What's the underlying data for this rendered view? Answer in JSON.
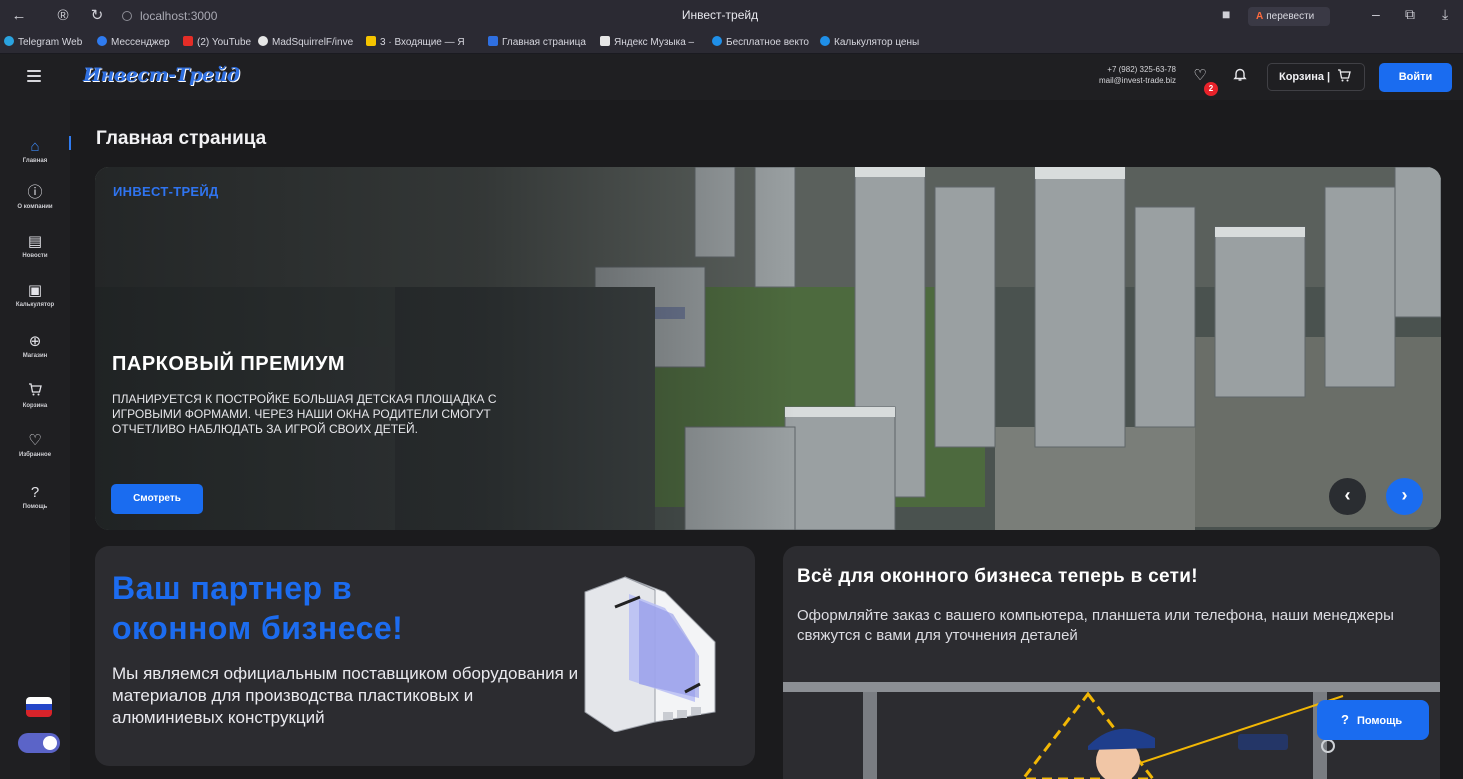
{
  "browser": {
    "url": "localhost:3000",
    "tab_title": "Инвест-трейд",
    "translate_label": "перевести",
    "bookmarks": [
      {
        "label": "Telegram Web",
        "color": "#2aa3e0"
      },
      {
        "label": "Мессенджер",
        "color": "#2f7bf0"
      },
      {
        "label": "(2) YouTube",
        "color": "#e52d27"
      },
      {
        "label": "MadSquirrelF/inve",
        "color": "#e6e6e6"
      },
      {
        "label": "3 · Входящие — Я",
        "color": "#f5c400"
      },
      {
        "label": "Главная страница",
        "color": "#2f6fe0"
      },
      {
        "label": "Яндекс Музыка –",
        "color": "#e6e6e6"
      },
      {
        "label": "Бесплатное векто",
        "color": "#1f8fe8"
      },
      {
        "label": "Калькулятор цены",
        "color": "#1f8fe8"
      }
    ]
  },
  "header": {
    "logo": "Инвест-Трейд",
    "phone": "+7 (982) 325-63-78",
    "email": "mail@invest-trade.biz",
    "favorites_count": "2",
    "cart_label": "Корзина |",
    "login_label": "Войти"
  },
  "sidebar": {
    "items": [
      {
        "label": "Главная",
        "icon": "home-icon"
      },
      {
        "label": "О компании",
        "icon": "question-circle-icon"
      },
      {
        "label": "Новости",
        "icon": "news-icon"
      },
      {
        "label": "Калькулятор",
        "icon": "calculator-icon"
      },
      {
        "label": "Магазин",
        "icon": "shop-icon"
      },
      {
        "label": "Корзина",
        "icon": "cart-icon"
      },
      {
        "label": "Избранное",
        "icon": "heart-icon"
      },
      {
        "label": "Помощь",
        "icon": "question-icon"
      }
    ]
  },
  "main": {
    "page_title": "Главная страница",
    "hero": {
      "brand": "ИНВЕСТ-ТРЕЙД",
      "title": "ПАРКОВЫЙ ПРЕМИУМ",
      "description": "Планируется к постройке большая детская площадка с игровыми формами. Через наши окна родители смогут отчетливо наблюдать за игрой своих детей.",
      "button_label": "Смотреть"
    },
    "partner": {
      "title_line1": "Ваш партнер в",
      "title_line2": "оконном бизнесе!",
      "description": "Мы являемся официальным поставщиком оборудования и материалов для производства пластиковых и алюминиевых конструкций"
    },
    "online": {
      "title": "Всё для оконного бизнеса теперь в сети!",
      "description": "Оформляйте заказ с вашего компьютера, планшета или телефона, наши менеджеры свяжутся с вами для уточнения деталей"
    }
  },
  "help_button_label": "Помощь",
  "colors": {
    "accent": "#1a6cf0",
    "background": "#1b1b1d",
    "card": "#2c2c30",
    "badge": "#e8222a"
  }
}
